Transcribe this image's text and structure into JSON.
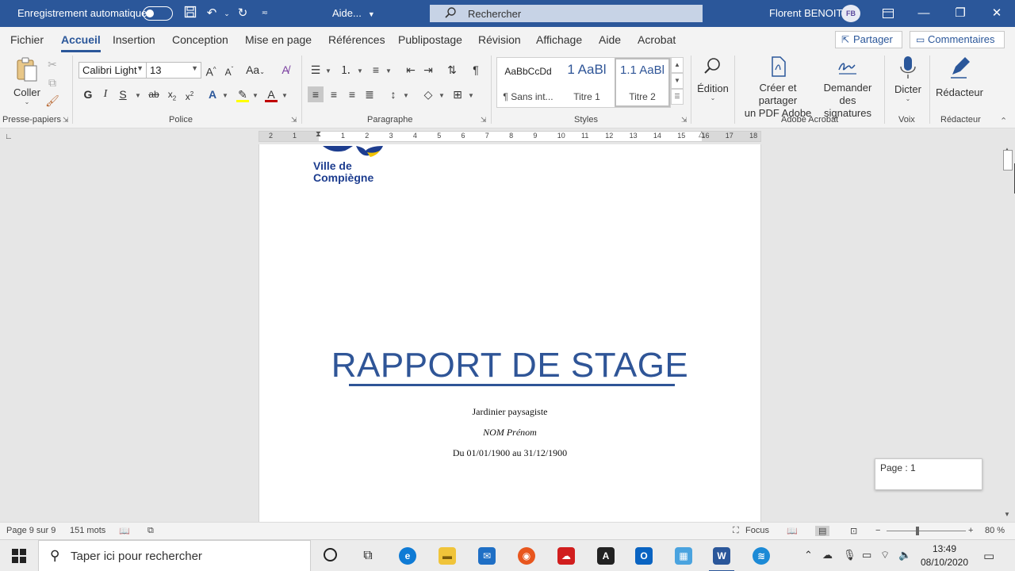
{
  "titlebar": {
    "autosave_label": "Enregistrement automatique",
    "doc_name": "Aide...",
    "search_placeholder": "Rechercher",
    "user_name": "Florent BENOIT",
    "user_initials": "FB"
  },
  "menu": {
    "tabs": [
      "Fichier",
      "Accueil",
      "Insertion",
      "Conception",
      "Mise en page",
      "Références",
      "Publipostage",
      "Révision",
      "Affichage",
      "Aide",
      "Acrobat"
    ],
    "active_tab": "Accueil",
    "share_label": "Partager",
    "comments_label": "Commentaires"
  },
  "ribbon": {
    "clipboard": {
      "paste_label": "Coller",
      "group_label": "Presse-papiers"
    },
    "font": {
      "font_name": "Calibri Light",
      "font_size": "13",
      "group_label": "Police"
    },
    "paragraph": {
      "group_label": "Paragraphe"
    },
    "styles": {
      "group_label": "Styles",
      "items": [
        {
          "preview": "AaBbCcDd",
          "name": "¶ Sans int..."
        },
        {
          "preview": "1  AaBl",
          "name": "Titre 1"
        },
        {
          "preview": "1.1  AaBl",
          "name": "Titre 2"
        }
      ]
    },
    "editing": {
      "label": "Édition"
    },
    "acrobat": {
      "create_pdf_line1": "Créer et partager",
      "create_pdf_line2": "un PDF Adobe",
      "signatures_line1": "Demander",
      "signatures_line2": "des signatures",
      "group_label": "Adobe Acrobat"
    },
    "voice": {
      "dictate_label": "Dicter",
      "group_label": "Voix"
    },
    "editor": {
      "label": "Rédacteur",
      "group_label": "Rédacteur"
    }
  },
  "ruler": {
    "left_labels": [
      "2",
      "1"
    ],
    "right_labels": [
      "1",
      "2",
      "3",
      "4",
      "5",
      "6",
      "7",
      "8",
      "9",
      "10",
      "11",
      "12",
      "13",
      "14",
      "15",
      "16",
      "17",
      "18"
    ]
  },
  "document": {
    "logo_line1": "Ville de",
    "logo_line2": "Compiègne",
    "title": "RAPPORT DE STAGE",
    "subtitle": "Jardinier paysagiste",
    "author": "NOM Prénom",
    "dates": "Du 01/01/1900 au 31/12/1900"
  },
  "page_tooltip": "Page : 1",
  "statusbar": {
    "page_info": "Page 9 sur 9",
    "word_count": "151 mots",
    "focus_label": "Focus",
    "zoom_minus": "−",
    "zoom_plus": "+",
    "zoom_level": "80 %"
  },
  "taskbar": {
    "search_placeholder": "Taper ici pour rechercher",
    "time": "13:49",
    "date": "08/10/2020"
  },
  "colors": {
    "word_blue": "#2b579a",
    "title_blue": "#2f5597"
  }
}
